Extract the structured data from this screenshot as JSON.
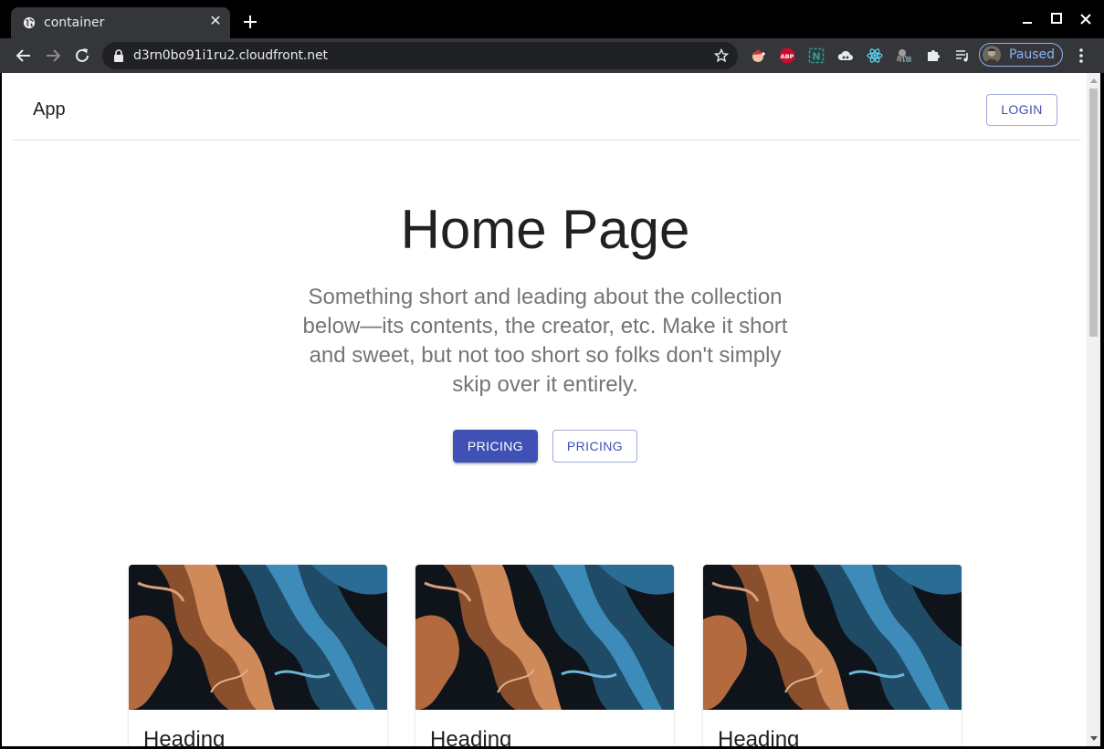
{
  "browser": {
    "tab": {
      "title": "container",
      "favicon": "globe-icon"
    },
    "url": "d3rn0bo91i1ru2.cloudfront.net",
    "profile_label": "Paused",
    "extensions": [
      "santa-icon",
      "adblock-plus-icon",
      "n-extension-icon",
      "cloud-icon",
      "react-icon",
      "octopus-icon",
      "puzzle-icon",
      "playlist-icon"
    ],
    "accent_color": "#8ab4f8"
  },
  "page": {
    "app_title": "App",
    "login_label": "LOGIN",
    "hero": {
      "title": "Home Page",
      "subtitle": "Something short and leading about the collection below—its contents, the creator, etc. Make it short and sweet, but not too short so folks don't simply skip over it entirely.",
      "primary_label": "PRICING",
      "secondary_label": "PRICING"
    },
    "cards": [
      {
        "heading": "Heading"
      },
      {
        "heading": "Heading"
      },
      {
        "heading": "Heading"
      }
    ],
    "primary_color": "#3f51b5"
  }
}
